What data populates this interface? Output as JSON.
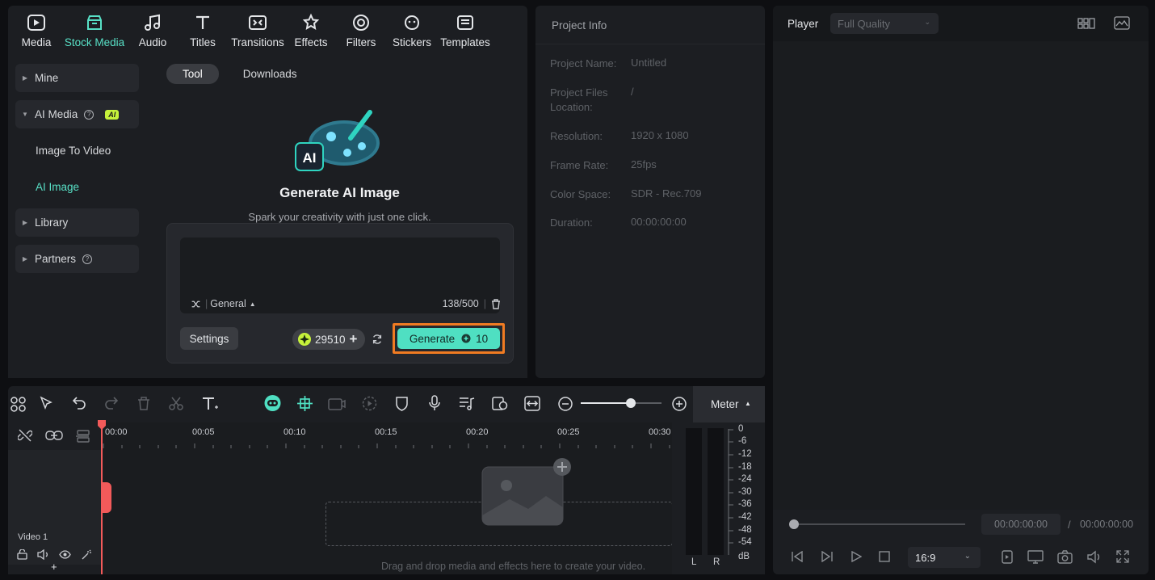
{
  "top_toolbar": {
    "items": [
      {
        "label": "Media",
        "icon": "media-icon"
      },
      {
        "label": "Stock Media",
        "icon": "stock-media-icon",
        "active": true
      },
      {
        "label": "Audio",
        "icon": "music-note-icon"
      },
      {
        "label": "Titles",
        "icon": "text-t-icon"
      },
      {
        "label": "Transitions",
        "icon": "transitions-icon"
      },
      {
        "label": "Effects",
        "icon": "effects-star-icon"
      },
      {
        "label": "Filters",
        "icon": "filters-icon"
      },
      {
        "label": "Stickers",
        "icon": "sticker-icon"
      },
      {
        "label": "Templates",
        "icon": "templates-icon"
      }
    ]
  },
  "left_nav": {
    "mine": "Mine",
    "ai_media": "AI Media",
    "ai_badge": "AI",
    "image_to_video": "Image To Video",
    "ai_image": "AI Image",
    "library": "Library",
    "partners": "Partners"
  },
  "generator": {
    "tabs": [
      "Tool",
      "Downloads"
    ],
    "title": "Generate AI Image",
    "subtitle": "Spark your creativity with just one click.",
    "style_label": "General",
    "char_count": "138/500",
    "settings_label": "Settings",
    "credits": "29510",
    "generate_label": "Generate",
    "generate_cost": "10"
  },
  "project_info": {
    "title": "Project Info",
    "rows": [
      {
        "k": "Project Name:",
        "v": "Untitled"
      },
      {
        "k": "Project Files Location:",
        "v": "/"
      },
      {
        "k": "Resolution:",
        "v": "1920 x 1080"
      },
      {
        "k": "Frame Rate:",
        "v": "25fps"
      },
      {
        "k": "Color Space:",
        "v": "SDR - Rec.709"
      },
      {
        "k": "Duration:",
        "v": "00:00:00:00"
      }
    ]
  },
  "player": {
    "title": "Player",
    "quality": "Full Quality",
    "current_time": "00:00:00:00",
    "separator": "/",
    "total_time": "00:00:00:00",
    "aspect_ratio": "16:9"
  },
  "timeline": {
    "meter_label": "Meter",
    "ruler_ticks": [
      "00:00",
      "00:05",
      "00:10",
      "00:15",
      "00:20",
      "00:25",
      "00:30"
    ],
    "track_name": "Video 1",
    "drop_hint": "Drag and drop media and effects here to create your video.",
    "meter_scale": [
      "0",
      "-6",
      "-12",
      "-18",
      "-24",
      "-30",
      "-36",
      "-42",
      "-48",
      "-54",
      "dB"
    ],
    "meter_channels": [
      "L",
      "R"
    ],
    "add_track": "+"
  },
  "colors": {
    "accent": "#58e0c6",
    "generate_bg": "#4fdfc2",
    "highlight_border": "#f07b22",
    "playhead": "#f25a5a"
  }
}
